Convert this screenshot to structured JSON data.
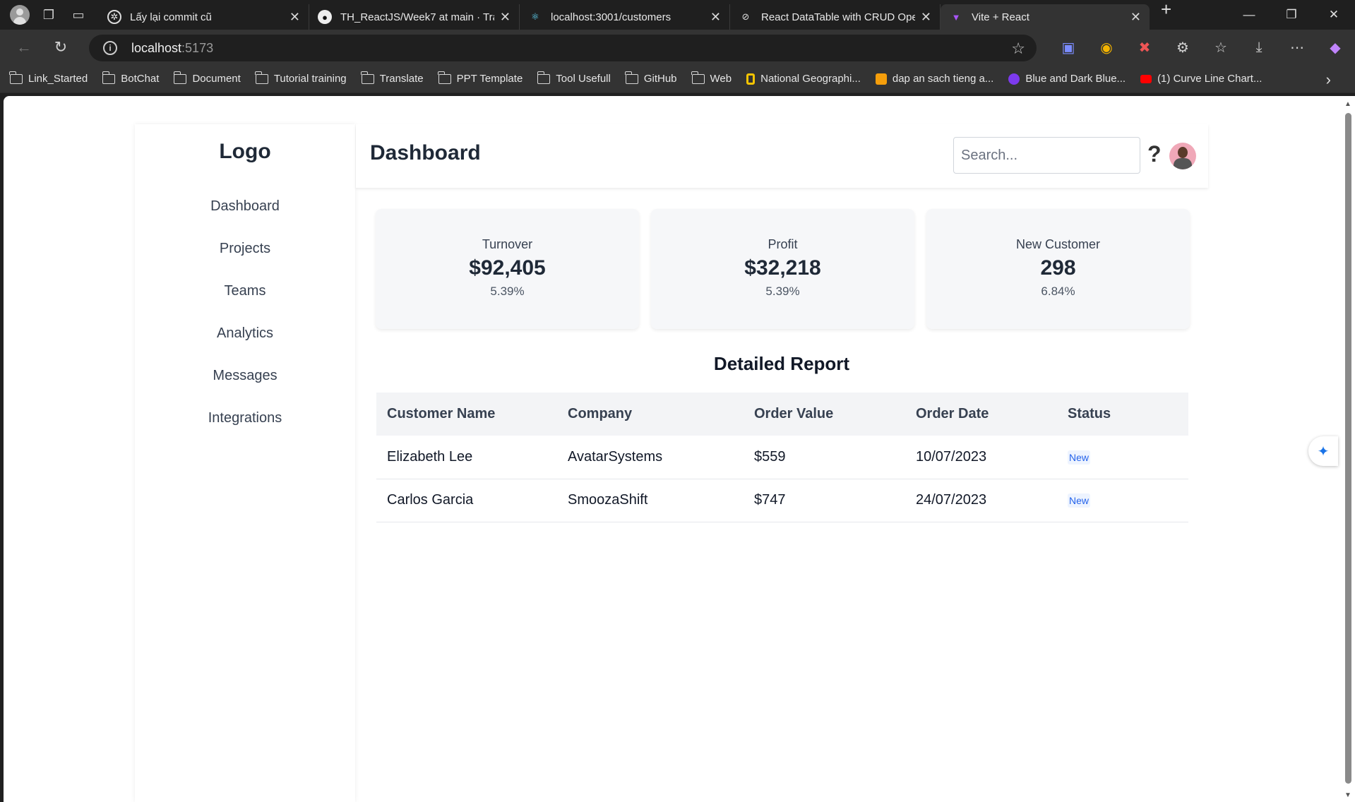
{
  "browser": {
    "tabs": [
      {
        "title": "Lấy lại commit cũ",
        "icon": "openai-icon"
      },
      {
        "title": "TH_ReactJS/Week7 at main · Trang",
        "icon": "github-icon"
      },
      {
        "title": "localhost:3001/customers",
        "icon": "react-icon"
      },
      {
        "title": "React DataTable with CRUD Oper",
        "icon": "codesandbox-icon"
      },
      {
        "title": "Vite + React",
        "icon": "vite-icon"
      }
    ],
    "url_host": "localhost",
    "url_port": ":5173",
    "bookmarks": [
      {
        "label": "Link_Started"
      },
      {
        "label": "BotChat"
      },
      {
        "label": "Document"
      },
      {
        "label": "Tutorial training"
      },
      {
        "label": "Translate"
      },
      {
        "label": "PPT Template"
      },
      {
        "label": "Tool Usefull"
      },
      {
        "label": "GitHub"
      },
      {
        "label": "Web"
      },
      {
        "label": "National Geographi..."
      },
      {
        "label": "dap an sach tieng a..."
      },
      {
        "label": "Blue and Dark Blue..."
      },
      {
        "label": "(1) Curve Line Chart..."
      }
    ]
  },
  "sidebar": {
    "logo": "Logo",
    "items": [
      {
        "label": "Dashboard"
      },
      {
        "label": "Projects"
      },
      {
        "label": "Teams"
      },
      {
        "label": "Analytics"
      },
      {
        "label": "Messages"
      },
      {
        "label": "Integrations"
      }
    ]
  },
  "header": {
    "title": "Dashboard",
    "search_placeholder": "Search...",
    "help": "?"
  },
  "cards": [
    {
      "label": "Turnover",
      "value": "$92,405",
      "percent": "5.39%"
    },
    {
      "label": "Profit",
      "value": "$32,218",
      "percent": "5.39%"
    },
    {
      "label": "New Customer",
      "value": "298",
      "percent": "6.84%"
    }
  ],
  "report": {
    "title": "Detailed Report",
    "columns": [
      "Customer Name",
      "Company",
      "Order Value",
      "Order Date",
      "Status"
    ],
    "rows": [
      {
        "name": "Elizabeth Lee",
        "company": "AvatarSystems",
        "value": "$559",
        "date": "10/07/2023",
        "status": "New"
      },
      {
        "name": "Carlos Garcia",
        "company": "SmoozaShift",
        "value": "$747",
        "date": "24/07/2023",
        "status": "New"
      }
    ]
  }
}
